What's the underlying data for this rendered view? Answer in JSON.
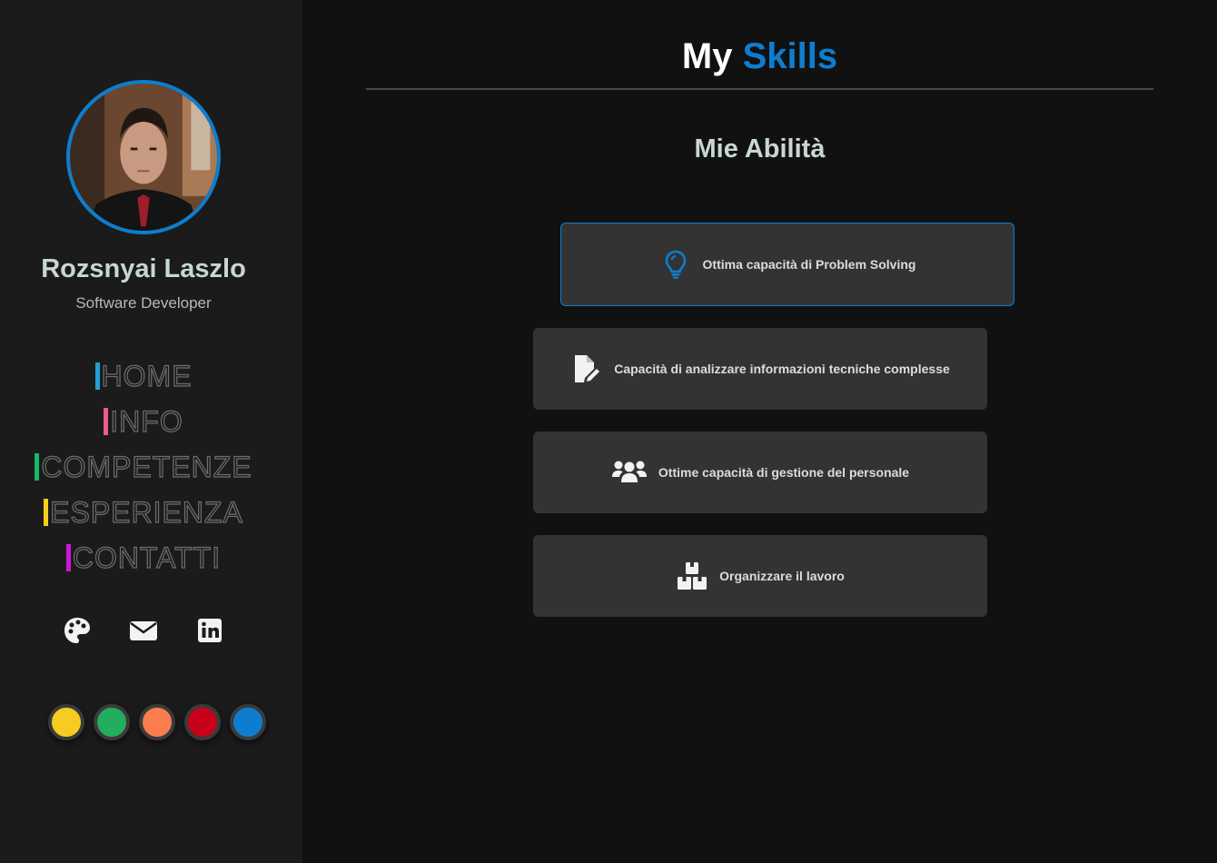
{
  "profile": {
    "name": "Rozsnyai Laszlo",
    "role": "Software Developer"
  },
  "nav": [
    {
      "label": "HOME",
      "accent": "#1fa0d8"
    },
    {
      "label": "INFO",
      "accent": "#ee5d8a"
    },
    {
      "label": "COMPETENZE",
      "accent": "#17b866"
    },
    {
      "label": "ESPERIENZA",
      "accent": "#f5d019"
    },
    {
      "label": "CONTATTI",
      "accent": "#d114d6"
    }
  ],
  "social": [
    {
      "icon": "palette-icon"
    },
    {
      "icon": "envelope-icon"
    },
    {
      "icon": "linkedin-icon"
    }
  ],
  "theme_colors": [
    "#f7cc22",
    "#22ae5e",
    "#fb7d4e",
    "#c9001a",
    "#0d7ecf"
  ],
  "header": {
    "title_prefix": "My",
    "title_accent": "Skills",
    "subtitle": "Mie Abilità"
  },
  "skills": [
    {
      "label": "Ottima capacità di Problem Solving",
      "icon": "lightbulb-icon",
      "active": true
    },
    {
      "label": "Capacità di analizzare informazioni tecniche complesse",
      "icon": "file-edit-icon",
      "active": false
    },
    {
      "label": "Ottime capacità di gestione del personale",
      "icon": "users-icon",
      "active": false
    },
    {
      "label": "Organizzare il lavoro",
      "icon": "boxes-icon",
      "active": false
    }
  ],
  "colors": {
    "accent": "#0d7ecf",
    "sidebar_bg": "#1b1b1b",
    "main_bg": "#111111",
    "card_bg": "#333333"
  }
}
